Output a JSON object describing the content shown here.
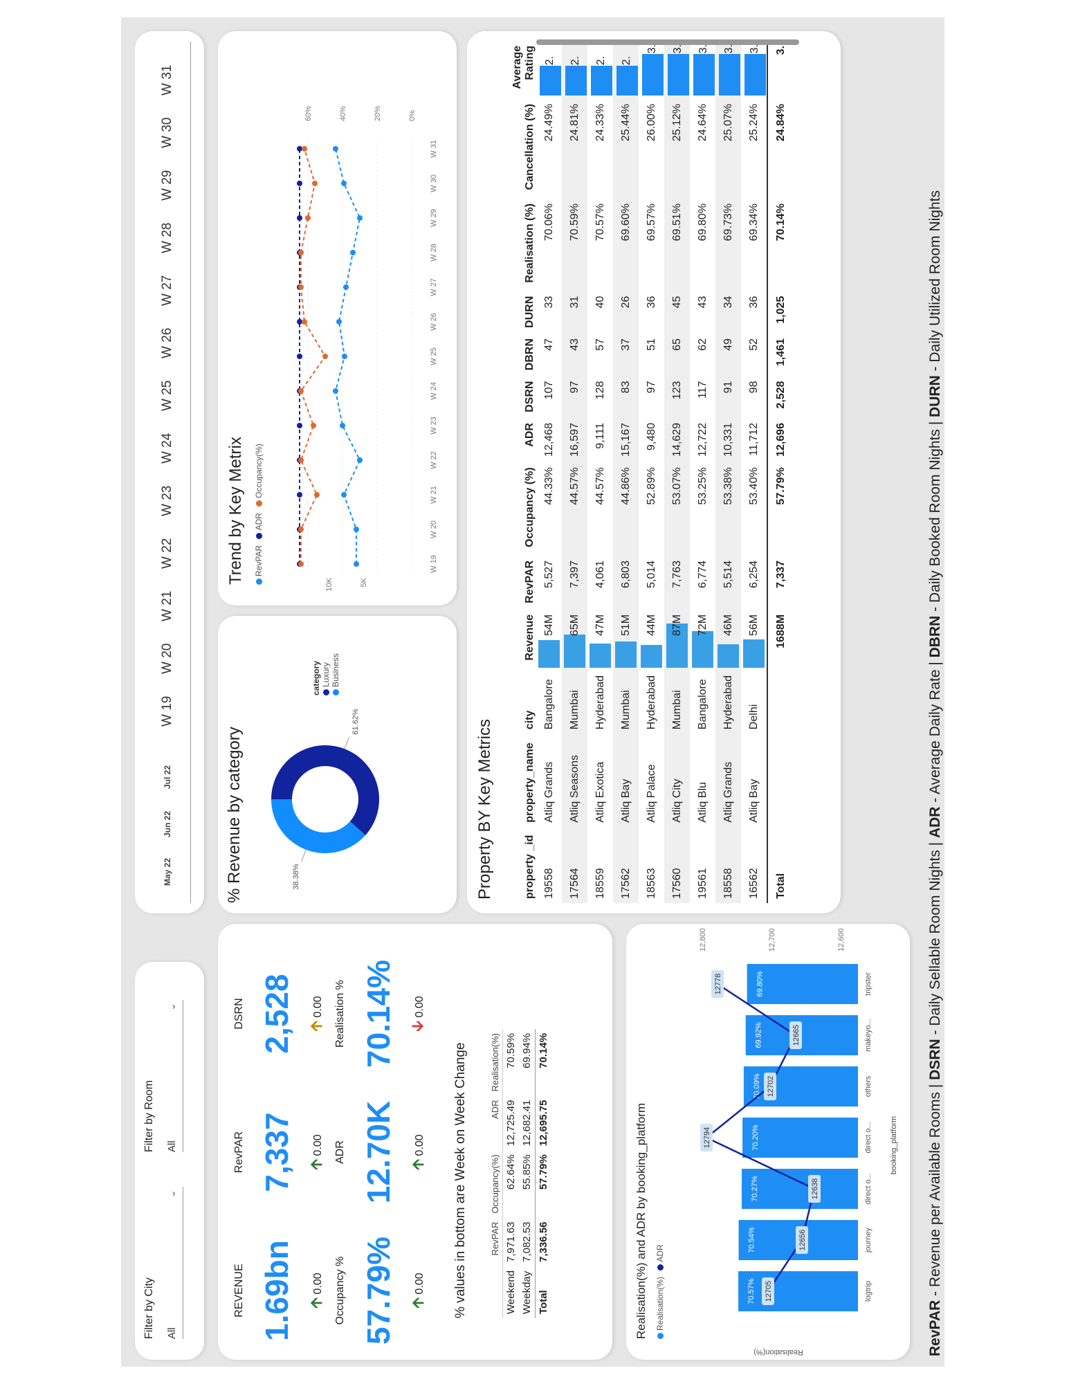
{
  "filters": {
    "city_label": "Filter by City",
    "city_value": "All",
    "room_label": "Filter by Room",
    "room_value": "All"
  },
  "timeline": {
    "months": [
      "May 22",
      "Jun 22",
      "Jul 22"
    ],
    "weeks": [
      "W 19",
      "W 20",
      "W 21",
      "W 22",
      "W 23",
      "W 24",
      "W 25",
      "W 26",
      "W 27",
      "W 28",
      "W 29",
      "W 30",
      "W 31"
    ]
  },
  "kpis": {
    "revenue": {
      "label": "REVENUE",
      "value": "1.69bn",
      "delta": "0.00"
    },
    "revpar": {
      "label": "RevPAR",
      "value": "7,337",
      "delta": "0.00"
    },
    "dsrn": {
      "label": "DSRN",
      "value": "2,528",
      "delta": "0.00"
    },
    "occupancy": {
      "label": "Occupancy %",
      "value": "57.79%",
      "delta": "0.00"
    },
    "adr": {
      "label": "ADR",
      "value": "12.70K",
      "delta": "0.00"
    },
    "realisation": {
      "label": "Realisation %",
      "value": "70.14%",
      "delta": "0.00"
    },
    "note": "% values in bottom are Week on Week Change"
  },
  "weektype_table": {
    "headers": [
      "",
      "RevPAR",
      "Occupancy(%)",
      "ADR",
      "Realisation(%)"
    ],
    "rows": [
      [
        "Weekend",
        "7,971.63",
        "62.64%",
        "12,725.49",
        "70.59%"
      ],
      [
        "Weekday",
        "7,082.53",
        "55.85%",
        "12,682.41",
        "69.94%"
      ]
    ],
    "total": [
      "Total",
      "7,336.56",
      "57.79%",
      "12,695.75",
      "70.14%"
    ]
  },
  "donut": {
    "title": "% Revenue by category",
    "legend_title": "category",
    "slices": [
      {
        "name": "Luxury",
        "value": 61.62,
        "label": "61.62%",
        "color": "#12239e"
      },
      {
        "name": "Business",
        "value": 38.38,
        "label": "38.38%",
        "color": "#118dff"
      }
    ]
  },
  "trend": {
    "title": "Trend by Key Metrix",
    "legend": [
      {
        "name": "RevPAR",
        "color": "#1e8ef5"
      },
      {
        "name": "ADR",
        "color": "#12239e"
      },
      {
        "name": "Occupancy(%)",
        "color": "#e06a2c"
      }
    ],
    "x_ticks": [
      "W 19",
      "W 20",
      "W 21",
      "W 22",
      "W 23",
      "W 24",
      "W 25",
      "W 26",
      "W 27",
      "W 28",
      "W 29",
      "W 30",
      "W 31"
    ],
    "y_left_ticks": [
      "5K",
      "10K"
    ],
    "y_right_ticks": [
      "0%",
      "20%",
      "40%",
      "60%"
    ]
  },
  "property_table": {
    "title": "Property BY Key Metrics",
    "headers": [
      "property _id",
      "property_name",
      "city",
      "Revenue",
      "RevPAR",
      "Occupancy (%)",
      "ADR",
      "DSRN",
      "DBRN",
      "DURN",
      "Realisation (%)",
      "Cancellation (%)",
      "Average Rating"
    ],
    "rows": [
      {
        "id": "19558",
        "name": "Atliq Grands",
        "city": "Bangalore",
        "revenue": "54M",
        "rev_share": 0.62,
        "revpar": "5,527",
        "occ": "44.33%",
        "adr": "12,468",
        "dsrn": "107",
        "dbrn": "47",
        "durn": "33",
        "real": "70.06%",
        "canc": "24.49%",
        "rating": "2.",
        "rating_share": 0.72
      },
      {
        "id": "17564",
        "name": "Atliq Seasons",
        "city": "Mumbai",
        "revenue": "65M",
        "rev_share": 0.75,
        "revpar": "7,397",
        "occ": "44.57%",
        "adr": "16,597",
        "dsrn": "97",
        "dbrn": "43",
        "durn": "31",
        "real": "70.59%",
        "canc": "24.81%",
        "rating": "2.",
        "rating_share": 0.72
      },
      {
        "id": "18559",
        "name": "Atliq Exotica",
        "city": "Hyderabad",
        "revenue": "47M",
        "rev_share": 0.54,
        "revpar": "4,061",
        "occ": "44.57%",
        "adr": "9,111",
        "dsrn": "128",
        "dbrn": "57",
        "durn": "40",
        "real": "70.57%",
        "canc": "24.33%",
        "rating": "2.",
        "rating_share": 0.72
      },
      {
        "id": "17562",
        "name": "Atliq Bay",
        "city": "Mumbai",
        "revenue": "51M",
        "rev_share": 0.59,
        "revpar": "6,803",
        "occ": "44.86%",
        "adr": "15,167",
        "dsrn": "83",
        "dbrn": "37",
        "durn": "26",
        "real": "69.60%",
        "canc": "25.44%",
        "rating": "2.",
        "rating_share": 0.72
      },
      {
        "id": "18563",
        "name": "Atliq Palace",
        "city": "Hyderabad",
        "revenue": "44M",
        "rev_share": 0.51,
        "revpar": "5,014",
        "occ": "52.89%",
        "adr": "9,480",
        "dsrn": "97",
        "dbrn": "51",
        "durn": "36",
        "real": "69.57%",
        "canc": "26.00%",
        "rating": "3.",
        "rating_share": 1.0
      },
      {
        "id": "17560",
        "name": "Atliq City",
        "city": "Mumbai",
        "revenue": "87M",
        "rev_share": 1.0,
        "revpar": "7,763",
        "occ": "53.07%",
        "adr": "14,629",
        "dsrn": "123",
        "dbrn": "65",
        "durn": "45",
        "real": "69.51%",
        "canc": "25.12%",
        "rating": "3.",
        "rating_share": 1.0
      },
      {
        "id": "19561",
        "name": "Atliq Blu",
        "city": "Bangalore",
        "revenue": "72M",
        "rev_share": 0.83,
        "revpar": "6,774",
        "occ": "53.25%",
        "adr": "12,722",
        "dsrn": "117",
        "dbrn": "62",
        "durn": "43",
        "real": "69.80%",
        "canc": "24.64%",
        "rating": "3.",
        "rating_share": 1.0
      },
      {
        "id": "18558",
        "name": "Atliq Grands",
        "city": "Hyderabad",
        "revenue": "46M",
        "rev_share": 0.53,
        "revpar": "5,514",
        "occ": "53.38%",
        "adr": "10,331",
        "dsrn": "91",
        "dbrn": "49",
        "durn": "34",
        "real": "69.73%",
        "canc": "25.07%",
        "rating": "3.",
        "rating_share": 1.0
      },
      {
        "id": "16562",
        "name": "Atliq Bay",
        "city": "Delhi",
        "revenue": "56M",
        "rev_share": 0.64,
        "revpar": "6,254",
        "occ": "53.40%",
        "adr": "11,712",
        "dsrn": "98",
        "dbrn": "52",
        "durn": "36",
        "real": "69.34%",
        "canc": "25.24%",
        "rating": "3.",
        "rating_share": 1.0
      }
    ],
    "total": {
      "label": "Total",
      "revenue": "1688M",
      "revpar": "7,337",
      "occ": "57.79%",
      "adr": "12,696",
      "dsrn": "2,528",
      "dbrn": "1,461",
      "durn": "1,025",
      "real": "70.14%",
      "canc": "24.84%",
      "rating": "3."
    }
  },
  "platform_chart": {
    "title": "Realisation(%) and ADR by booking_platform",
    "legend": [
      {
        "name": "Realisation(%)",
        "color": "#1e8ef5"
      },
      {
        "name": "ADR",
        "color": "#12239e"
      }
    ],
    "y_left_label": "Realisation(%)",
    "x_label": "booking_platform",
    "y_right_ticks": [
      "12,600",
      "12,700",
      "12,800"
    ]
  },
  "chart_data": {
    "type": "bar",
    "title": "Realisation(%) and ADR by booking_platform",
    "xlabel": "booking_platform",
    "ylabel": "Realisation(%)",
    "categories": [
      "logtrip",
      "journey",
      "direct o...",
      "direct o...",
      "others",
      "makeyo...",
      "tripster"
    ],
    "series": [
      {
        "name": "Realisation(%)",
        "type": "bar",
        "values": [
          70.57,
          70.54,
          70.27,
          70.2,
          70.09,
          69.92,
          69.8
        ],
        "labels": [
          "70.57%",
          "70.54%",
          "70.27%",
          "70.20%",
          "70.09%",
          "69.92%",
          "69.80%"
        ]
      },
      {
        "name": "ADR",
        "type": "line",
        "values": [
          12705,
          12656,
          12638,
          12794,
          12702,
          12665,
          12778
        ]
      }
    ],
    "y2lim": [
      12600,
      12800
    ]
  },
  "footer": {
    "parts": [
      {
        "b": "RevPAR",
        "t": " - Revenue per Available Rooms | "
      },
      {
        "b": "DSRN",
        "t": " - Daily Sellable Room Nights | "
      },
      {
        "b": "ADR",
        "t": " - Average Daily Rate | "
      },
      {
        "b": "DBRN",
        "t": " - Daily Booked Room Nights | "
      },
      {
        "b": "DURN",
        "t": " - Daily Utilized Room Nights"
      }
    ]
  }
}
